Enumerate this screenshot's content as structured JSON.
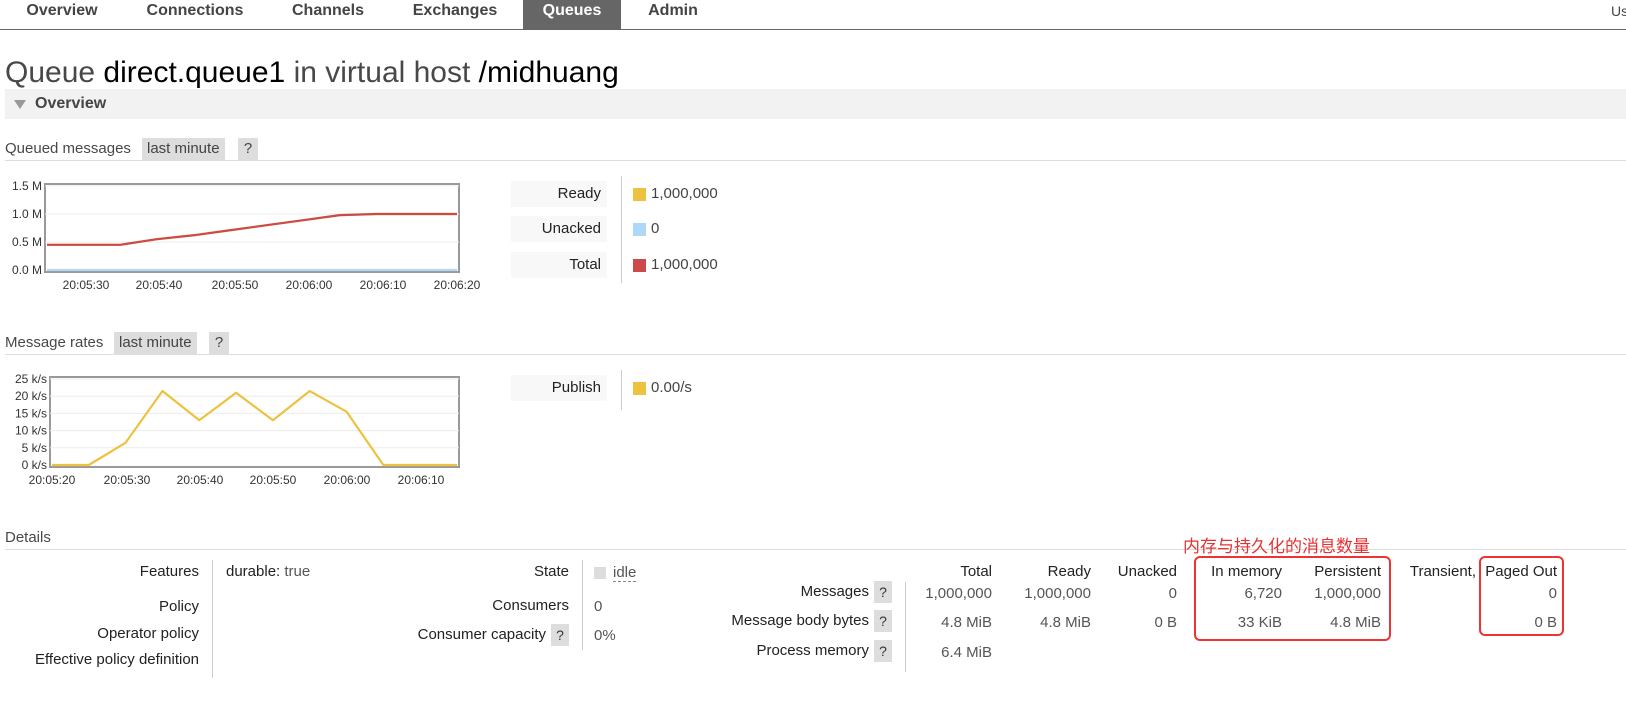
{
  "nav": {
    "tabs": [
      {
        "label": "Overview"
      },
      {
        "label": "Connections"
      },
      {
        "label": "Channels"
      },
      {
        "label": "Exchanges"
      },
      {
        "label": "Queues"
      },
      {
        "label": "Admin"
      }
    ],
    "active_tab": "Queues",
    "user_truncated": "Us"
  },
  "page": {
    "prefix": "Queue",
    "queue_name": "direct.queue1",
    "middle": "in virtual host",
    "vhost": "/midhuang"
  },
  "overview": {
    "label": "Overview",
    "queued": {
      "title": "Queued messages",
      "range_label": "last minute",
      "help": "?",
      "legend": [
        {
          "label": "Ready",
          "value": "1,000,000",
          "color": "#edc240"
        },
        {
          "label": "Unacked",
          "value": "0",
          "color": "#afd8f8"
        },
        {
          "label": "Total",
          "value": "1,000,000",
          "color": "#cb4b4b"
        }
      ]
    },
    "rates": {
      "title": "Message rates",
      "range_label": "last minute",
      "help": "?",
      "legend": [
        {
          "label": "Publish",
          "value": "0.00/s",
          "color": "#edc240"
        }
      ]
    }
  },
  "chart_data": [
    {
      "type": "line",
      "yticks": [
        "0.0 M",
        "0.5 M",
        "1.0 M",
        "1.5 M"
      ],
      "ylim": [
        0,
        1.5
      ],
      "xticks": [
        "20:05:30",
        "20:05:40",
        "20:05:50",
        "20:06:00",
        "20:06:10",
        "20:06:20"
      ],
      "xlim": [
        0,
        56
      ],
      "series": [
        {
          "name": "Total",
          "color": "#cb4b4b",
          "x": [
            0,
            10,
            15,
            20,
            25,
            30,
            35,
            40,
            45,
            50,
            56
          ],
          "values": [
            0.45,
            0.45,
            0.55,
            0.62,
            0.71,
            0.8,
            0.89,
            0.98,
            1.0,
            1.0,
            1.0
          ]
        },
        {
          "name": "Ready",
          "color": "#edc240",
          "x": [
            0,
            10,
            15,
            20,
            25,
            30,
            35,
            40,
            45,
            50,
            56
          ],
          "values": [
            0.45,
            0.45,
            0.55,
            0.62,
            0.71,
            0.8,
            0.89,
            0.98,
            1.0,
            1.0,
            1.0
          ]
        },
        {
          "name": "Unacked",
          "color": "#afd8f8",
          "x": [
            0,
            56
          ],
          "values": [
            0,
            0
          ]
        }
      ]
    },
    {
      "type": "line",
      "yticks": [
        "0 k/s",
        "5 k/s",
        "10 k/s",
        "15 k/s",
        "20 k/s",
        "25 k/s"
      ],
      "ylim": [
        0,
        25
      ],
      "xticks": [
        "20:05:20",
        "20:05:30",
        "20:05:40",
        "20:05:50",
        "20:06:00",
        "20:06:10"
      ],
      "xlim": [
        0,
        55
      ],
      "series": [
        {
          "name": "Publish",
          "color": "#edc240",
          "x": [
            0,
            5,
            10,
            15,
            20,
            25,
            30,
            35,
            40,
            45,
            50,
            55
          ],
          "values": [
            0,
            0,
            6.5,
            21.5,
            13,
            21,
            13,
            21.5,
            15.5,
            0,
            0,
            0
          ]
        }
      ]
    }
  ],
  "details": {
    "title": "Details",
    "features": {
      "label": "Features",
      "key": "durable:",
      "value": "true"
    },
    "policy": {
      "label": "Policy"
    },
    "operator_policy": {
      "label": "Operator policy"
    },
    "effective_policy": {
      "label": "Effective policy definition"
    },
    "state": {
      "label": "State",
      "value": "idle"
    },
    "consumers": {
      "label": "Consumers",
      "value": "0"
    },
    "consumer_capacity": {
      "label": "Consumer capacity",
      "help": "?",
      "value": "0%"
    },
    "columns": [
      "Total",
      "Ready",
      "Unacked",
      "In memory",
      "Persistent",
      "Transient,",
      "Paged Out"
    ],
    "rows": [
      {
        "label": "Messages",
        "help": "?",
        "values": [
          "1,000,000",
          "1,000,000",
          "0",
          "6,720",
          "1,000,000",
          "",
          "0"
        ]
      },
      {
        "label": "Message body bytes",
        "help": "?",
        "values": [
          "4.8 MiB",
          "4.8 MiB",
          "0 B",
          "33 KiB",
          "4.8 MiB",
          "",
          "0 B"
        ]
      },
      {
        "label": "Process memory",
        "help": "?",
        "values": [
          "6.4 MiB"
        ]
      }
    ]
  },
  "annotation": {
    "text": "内存与持久化的消息数量",
    "color": "#e33333"
  }
}
